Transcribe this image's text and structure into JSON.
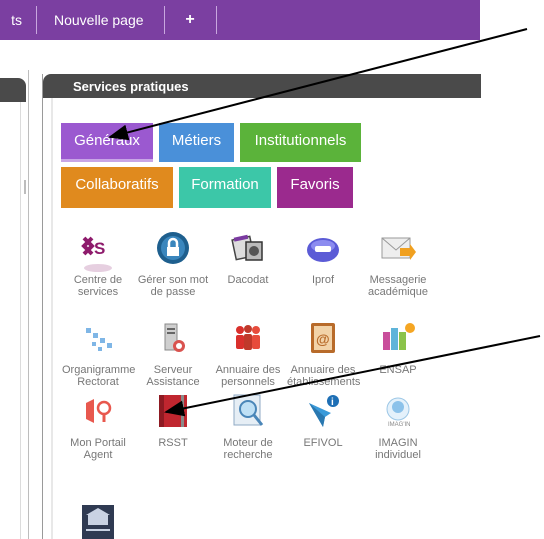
{
  "nav": {
    "tabs": [
      {
        "label": "ts"
      },
      {
        "label": "Nouvelle page"
      },
      {
        "label": "+"
      }
    ]
  },
  "panel": {
    "title": "Services pratiques"
  },
  "categories": [
    {
      "label": "Généraux",
      "color": "#9b59d0"
    },
    {
      "label": "Métiers",
      "color": "#4a90d9"
    },
    {
      "label": "Institutionnels",
      "color": "#5bb33a"
    },
    {
      "label": "Collaboratifs",
      "color": "#e08a1e"
    },
    {
      "label": "Formation",
      "color": "#3cc7a8"
    },
    {
      "label": "Favoris",
      "color": "#9b2a8e"
    }
  ],
  "services": [
    {
      "label": "Centre de services",
      "icon": "cs-logo-icon"
    },
    {
      "label": "Gérer son mot de passe",
      "icon": "lock-icon"
    },
    {
      "label": "Dacodat",
      "icon": "dacodat-icon"
    },
    {
      "label": "Iprof",
      "icon": "iprof-icon"
    },
    {
      "label": "Messagerie académique",
      "icon": "mail-icon"
    },
    {
      "label": "Organigramme Rectorat",
      "icon": "org-chart-icon"
    },
    {
      "label": "Serveur Assistance",
      "icon": "server-icon"
    },
    {
      "label": "Annuaire des personnels",
      "icon": "people-icon"
    },
    {
      "label": "Annuaire des établissements",
      "icon": "address-book-icon"
    },
    {
      "label": "ENSAP",
      "icon": "ensap-icon"
    },
    {
      "label": "Mon Portail Agent",
      "icon": "portal-icon"
    },
    {
      "label": "RSST",
      "icon": "book-icon"
    },
    {
      "label": "Moteur de recherche",
      "icon": "search-icon"
    },
    {
      "label": "EFIVOL",
      "icon": "efivol-icon"
    },
    {
      "label": "IMAGIN individuel",
      "icon": "imagin-icon"
    },
    {
      "label": "",
      "icon": "building-icon"
    }
  ],
  "colors": {
    "nav": "#7b3fa1",
    "header": "#4a4a4a",
    "label": "#777777"
  }
}
